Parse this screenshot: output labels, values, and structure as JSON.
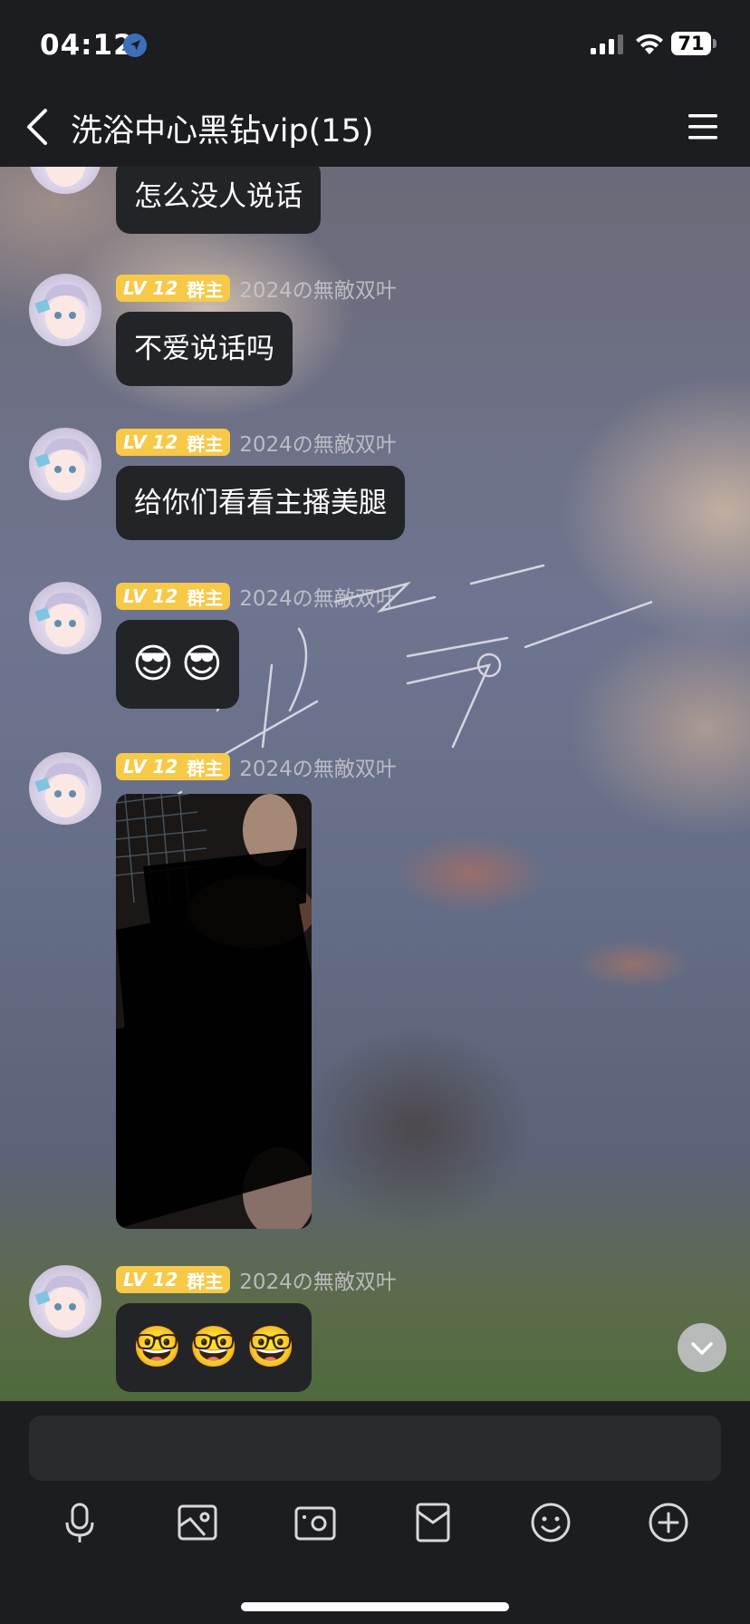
{
  "status_bar": {
    "time": "04:12",
    "battery": "71",
    "icons": [
      "location-arrow-icon",
      "cellular-signal-icon",
      "wifi-icon",
      "battery-icon"
    ]
  },
  "header": {
    "title": "洗浴中心黑钻vip(15)",
    "back_icon": "chevron-left-icon",
    "menu_icon": "hamburger-menu-icon"
  },
  "messages": [
    {
      "type": "text",
      "text": "怎么没人说话"
    },
    {
      "type": "text",
      "level": "LV 12",
      "role": "群主",
      "sender": "2024の無敵双叶",
      "text": "不爱说话吗"
    },
    {
      "type": "text",
      "level": "LV 12",
      "role": "群主",
      "sender": "2024の無敵双叶",
      "text": "给你们看看主播美腿"
    },
    {
      "type": "emoji",
      "level": "LV 12",
      "role": "群主",
      "sender": "2024の無敵双叶",
      "emojis": [
        "😎",
        "😎"
      ]
    },
    {
      "type": "image",
      "level": "LV 12",
      "role": "群主",
      "sender": "2024の無敵双叶"
    },
    {
      "type": "emoji",
      "level": "LV 12",
      "role": "群主",
      "sender": "2024の無敵双叶",
      "emojis": [
        "🤓",
        "🤓",
        "🤓"
      ]
    }
  ],
  "input": {
    "placeholder": "",
    "tools": [
      "microphone-icon",
      "image-icon",
      "camera-icon",
      "red-packet-icon",
      "emoji-smile-icon",
      "plus-circle-icon"
    ]
  },
  "colors": {
    "background": "#1c1d20",
    "bubble": "#232427",
    "level_badge": "#f7c948",
    "input_field": "#2a2b2f"
  }
}
